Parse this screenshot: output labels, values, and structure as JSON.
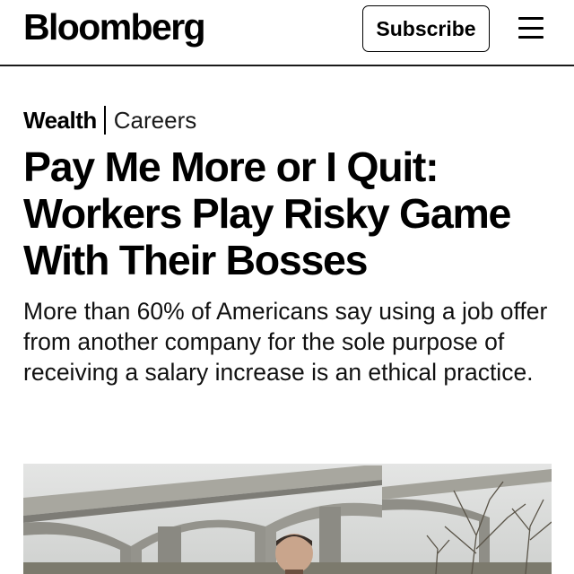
{
  "header": {
    "logo": "Bloomberg",
    "subscribe_label": "Subscribe",
    "menu_icon": "hamburger-menu-icon"
  },
  "article": {
    "section": "Wealth",
    "subsection": "Careers",
    "headline": "Pay Me More or I Quit: Workers Play Risky Game With Their Bosses",
    "dek": "More than 60% of Americans say using a job offer from another company for the sole purpose of receiving a salary increase is an ethical practice."
  },
  "colors": {
    "text": "#000000",
    "background": "#ffffff",
    "photo_sky": "#d4d6d6",
    "photo_concrete": "#9b9a93"
  }
}
